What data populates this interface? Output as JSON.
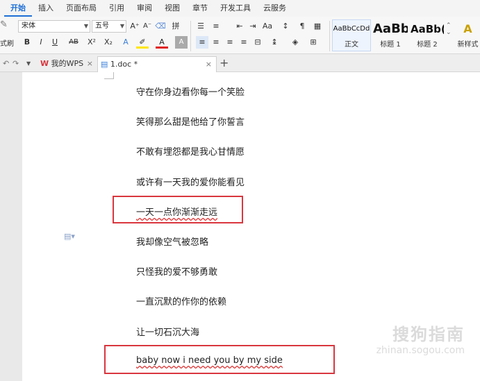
{
  "ribbon_tabs": [
    "开始",
    "插入",
    "页面布局",
    "引用",
    "审阅",
    "视图",
    "章节",
    "开发工具",
    "云服务"
  ],
  "toolbar": {
    "font_name": "宋体",
    "font_size": "五号",
    "left_stub_icon": "brush-icon",
    "left_stub_label": "式刷",
    "bold": "B",
    "italic": "I",
    "underline": "U",
    "strikethrough": "AB",
    "superscript": "X²",
    "subscript": "X₂",
    "grow_font": "A⁺",
    "shrink_font": "A⁻",
    "change_case": "Aa"
  },
  "styles": [
    {
      "preview": "AaBbCcDd",
      "name": "正文"
    },
    {
      "preview": "AaBb",
      "name": "标题 1"
    },
    {
      "preview": "AaBb(",
      "name": "标题 2"
    },
    {
      "preview": "A",
      "name": "新样式"
    }
  ],
  "doc_tabs": {
    "wps_label": "我的WPS",
    "doc_label": "1.doc *",
    "add": "+"
  },
  "document": {
    "lines": [
      "守在你身边看你每一个笑脸",
      "笑得那么甜是他给了你誓言",
      "不敢有埋怨都是我心甘情愿",
      "或许有一天我的爱你能看见",
      "一天一点你渐渐走远",
      "我却像空气被忽略",
      "只怪我的爱不够勇敢",
      "一直沉默的作你的依赖",
      "让一切石沉大海",
      "baby now i need you by my side"
    ]
  },
  "watermark": {
    "logo": "搜狗指南",
    "url": "zhinan.sogou.com"
  },
  "colors": {
    "accent": "#1e6fd6",
    "highlight_box": "#d9363e",
    "spell_underline": "#dd3333"
  }
}
